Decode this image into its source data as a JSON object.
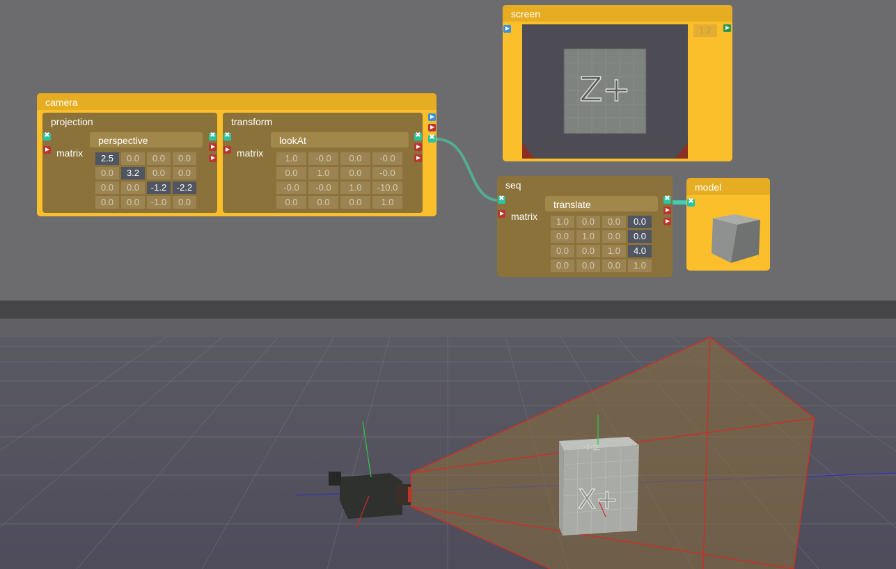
{
  "camera": {
    "title": "camera",
    "projection": {
      "title": "projection",
      "function": "perspective",
      "input_label": "matrix",
      "matrix": [
        [
          "2.5",
          "0.0",
          "0.0",
          "0.0"
        ],
        [
          "0.0",
          "3.2",
          "0.0",
          "0.0"
        ],
        [
          "0.0",
          "0.0",
          "-1.2",
          "-2.2"
        ],
        [
          "0.0",
          "0.0",
          "-1.0",
          "0.0"
        ]
      ],
      "highlighted": [
        [
          0,
          0
        ],
        [
          1,
          1
        ],
        [
          2,
          2
        ],
        [
          2,
          3
        ]
      ]
    },
    "transform": {
      "title": "transform",
      "function": "lookAt",
      "input_label": "matrix",
      "matrix": [
        [
          "1.0",
          "-0.0",
          "0.0",
          "-0.0"
        ],
        [
          "0.0",
          "1.0",
          "0.0",
          "-0.0"
        ],
        [
          "-0.0",
          "-0.0",
          "1.0",
          "-10.0"
        ],
        [
          "0.0",
          "0.0",
          "0.0",
          "1.0"
        ]
      ],
      "highlighted": []
    }
  },
  "screen": {
    "title": "screen",
    "value": "1.2",
    "preview_label": "Z+"
  },
  "seq": {
    "title": "seq",
    "function": "translate",
    "input_label": "matrix",
    "matrix": [
      [
        "1.0",
        "0.0",
        "0.0",
        "0.0"
      ],
      [
        "0.0",
        "1.0",
        "0.0",
        "0.0"
      ],
      [
        "0.0",
        "0.0",
        "1.0",
        "4.0"
      ],
      [
        "0.0",
        "0.0",
        "0.0",
        "1.0"
      ]
    ],
    "highlighted": [
      [
        0,
        3
      ],
      [
        1,
        3
      ],
      [
        2,
        3
      ]
    ]
  },
  "model": {
    "title": "model"
  },
  "viewport": {
    "cube_label": "X+",
    "cube_top_label": "Z+"
  },
  "colors": {
    "node": "#fbbf2c",
    "sub": "#8b723a",
    "connector": "#2ec2a0",
    "frustum": "#d42a24"
  }
}
